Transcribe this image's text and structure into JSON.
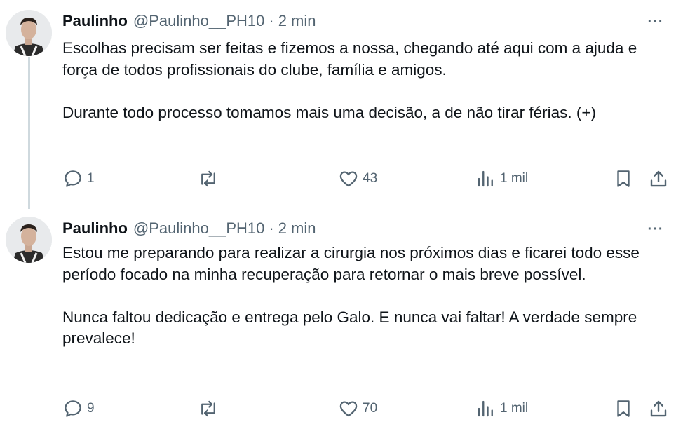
{
  "tweets": [
    {
      "name": "Paulinho",
      "handle": "@Paulinho__PH10",
      "separator": "·",
      "time": "2 min",
      "more_label": "···",
      "paragraphs": [
        "Escolhas precisam ser feitas e fizemos a nossa, chegando até aqui com a ajuda e força de todos profissionais do clube, família e amigos.",
        "Durante todo processo tomamos mais uma decisão, a de não tirar férias. (+)"
      ],
      "replies": "1",
      "retweets": "",
      "likes": "43",
      "views": "1 mil"
    },
    {
      "name": "Paulinho",
      "handle": "@Paulinho__PH10",
      "separator": "·",
      "time": "2 min",
      "more_label": "···",
      "paragraphs": [
        "Estou me preparando para realizar a cirurgia nos próximos dias e ficarei todo esse período focado na minha recuperação para retornar o mais breve possível.",
        "Nunca faltou dedicação e entrega pelo Galo. E nunca vai faltar! A verdade sempre prevalece!"
      ],
      "replies": "9",
      "retweets": "",
      "likes": "70",
      "views": "1 mil"
    }
  ],
  "icons": {
    "reply": "speech-bubble-icon",
    "retweet": "retweet-arrows-icon",
    "like": "heart-icon",
    "views": "bar-chart-icon",
    "bookmark": "bookmark-icon",
    "share": "upload-arrow-icon"
  },
  "colors": {
    "text": "#0f1419",
    "secondary": "#536471",
    "thread_line": "#cfd9de"
  }
}
